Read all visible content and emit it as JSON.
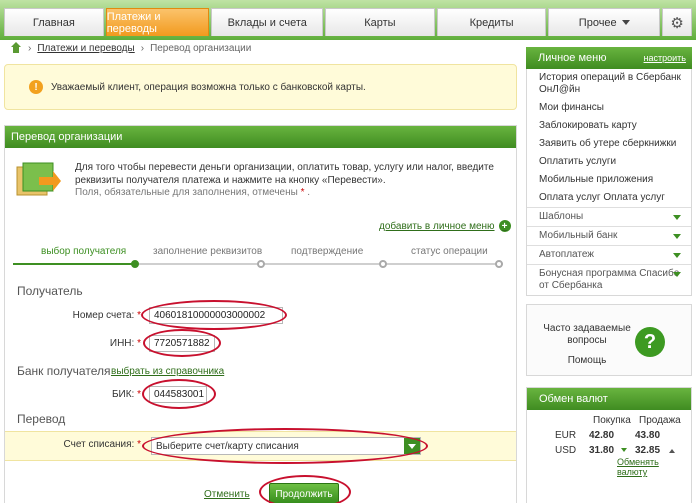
{
  "nav": {
    "tabs": [
      {
        "label": "Главная",
        "active": false
      },
      {
        "label": "Платежи и переводы",
        "active": true
      },
      {
        "label": "Вклады и счета",
        "active": false
      },
      {
        "label": "Карты",
        "active": false
      },
      {
        "label": "Кредиты",
        "active": false
      },
      {
        "label": "Прочее",
        "active": false
      }
    ],
    "settings_icon": "gear-icon"
  },
  "breadcrumb": {
    "icon": "home-icon",
    "items": [
      "Платежи и переводы",
      "Перевод организации"
    ]
  },
  "notice": {
    "icon": "warning-icon",
    "text": "Уважаемый клиент, операция возможна только с банковской карты."
  },
  "form": {
    "title": "Перевод организации",
    "intro": "Для того чтобы перевести деньги организации, оплатить товар, услугу или налог, введите реквизиты получателя платежа и нажмите на кнопку «Перевести».",
    "required_note": "Поля, обязательные для заполнения, отмечены",
    "required_mark": "*",
    "add_to_menu": "добавить в личное меню",
    "steps": [
      "выбор получателя",
      "заполнение реквизитов",
      "подтверждение",
      "статус операции"
    ],
    "recipient_section": "Получатель",
    "account_label": "Номер счета:",
    "account_value": "40601810000003000002",
    "inn_label": "ИНН:",
    "inn_value": "7720571882",
    "bank_section": "Банк получателя",
    "from_directory": "выбрать из справочника",
    "bik_label": "БИК:",
    "bik_value": "044583001",
    "transfer_section": "Перевод",
    "debit_label": "Счет списания:",
    "debit_placeholder": "Выберите счет/карту списания",
    "cancel": "Отменить",
    "continue": "Продолжить"
  },
  "personal_menu": {
    "title": "Личное меню",
    "configure": "настроить",
    "items": [
      {
        "label": "История операций в Сбербанк ОнЛ@йн",
        "group": false
      },
      {
        "label": "Мои финансы",
        "group": false
      },
      {
        "label": "Заблокировать карту",
        "group": false
      },
      {
        "label": "Заявить об утере сберкнижки",
        "group": false
      },
      {
        "label": "Оплатить услуги",
        "group": false
      },
      {
        "label": "Мобильные приложения",
        "group": false
      },
      {
        "label": "Оплата услуг Оплата услуг",
        "group": false
      },
      {
        "label": "Шаблоны",
        "group": true
      },
      {
        "label": "Мобильный банк",
        "group": true
      },
      {
        "label": "Автоплатеж",
        "group": true
      },
      {
        "label": "Бонусная программа Спасибо от Сбербанка",
        "group": true
      }
    ]
  },
  "faq": {
    "text": "Часто задаваемые вопросы",
    "help": "Помощь",
    "icon": "help-icon"
  },
  "exchange": {
    "title": "Обмен валют",
    "buy_header": "Покупка",
    "sell_header": "Продажа",
    "rates": [
      {
        "currency": "EUR",
        "buy": "42.80",
        "sell": "43.80"
      },
      {
        "currency": "USD",
        "buy": "31.80",
        "sell": "32.85"
      }
    ],
    "link": "Обменять валюту"
  },
  "colors": {
    "brand_green": "#3d8f22",
    "active_tab": "#f29a1e",
    "notice_bg": "#fffbd9",
    "highlight": "#c8102e"
  }
}
